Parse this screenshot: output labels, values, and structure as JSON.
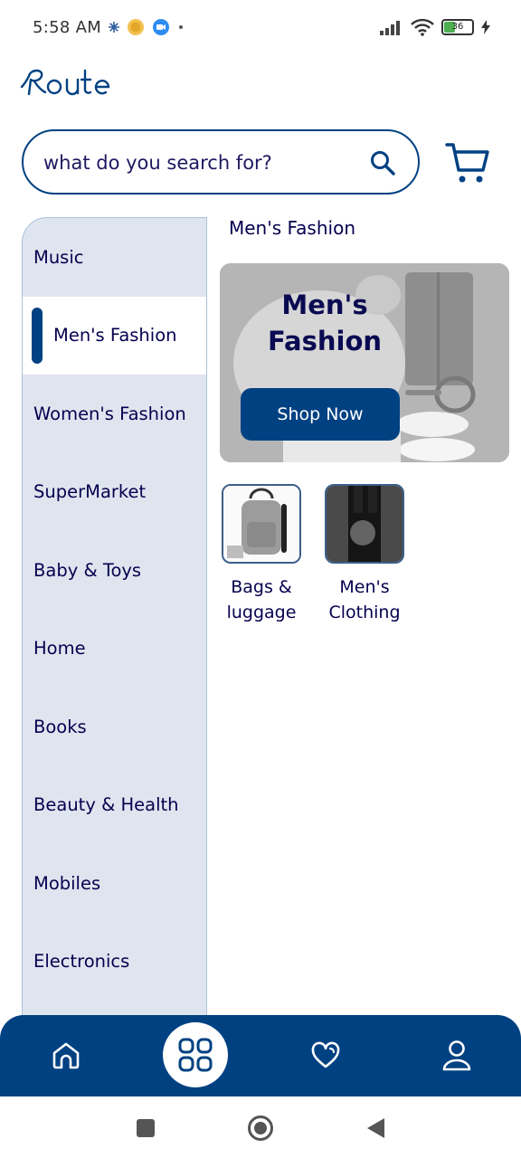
{
  "status_bar": {
    "time": "5:58 AM",
    "battery": "36"
  },
  "app": {
    "logo_text": "Route"
  },
  "search": {
    "placeholder": "what do you search for?"
  },
  "sidebar": {
    "items": [
      {
        "label": "Music"
      },
      {
        "label": "Men's Fashion"
      },
      {
        "label": "Women's Fashion"
      },
      {
        "label": "SuperMarket"
      },
      {
        "label": "Baby & Toys"
      },
      {
        "label": "Home"
      },
      {
        "label": "Books"
      },
      {
        "label": "Beauty & Health"
      },
      {
        "label": "Mobiles"
      },
      {
        "label": "Electronics"
      }
    ],
    "active_index": 1
  },
  "content": {
    "section_title": "Men's Fashion",
    "banner": {
      "title_line1": "Men's",
      "title_line2": "Fashion",
      "button_label": "Shop Now"
    },
    "subcategories": [
      {
        "label_line1": "Bags &",
        "label_line2": "luggage"
      },
      {
        "label_line1": "Men's",
        "label_line2": "Clothing"
      }
    ]
  },
  "bottom_nav": {
    "items": [
      "home-icon",
      "categories-icon",
      "heart-icon",
      "profile-icon"
    ],
    "active": "categories-icon"
  },
  "colors": {
    "primary": "#004182",
    "text": "#06004f",
    "sidebar_bg": "#dfe5ef"
  }
}
